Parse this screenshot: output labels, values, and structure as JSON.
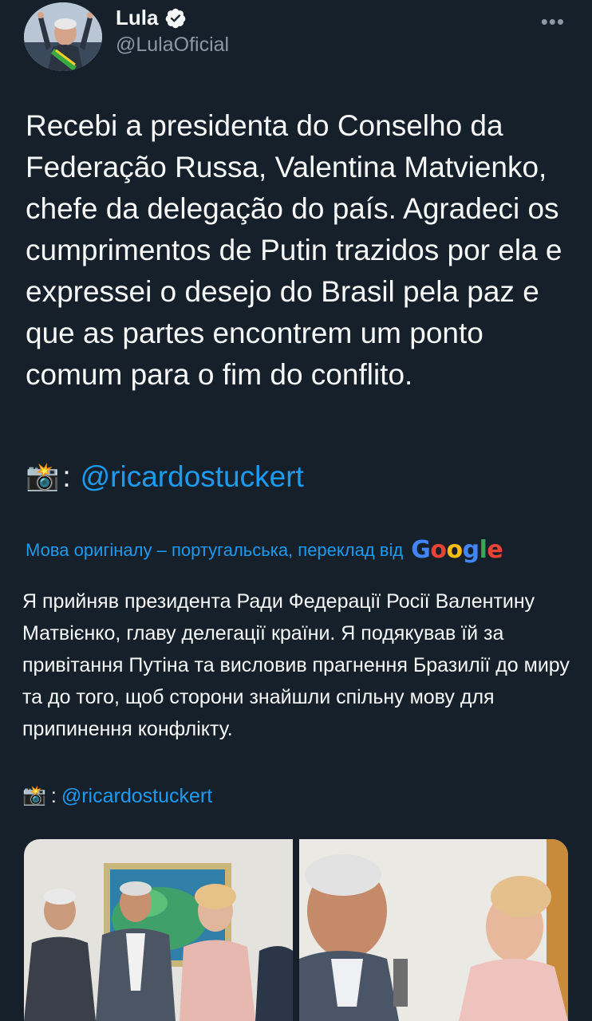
{
  "header": {
    "name": "Lula",
    "handle": "@LulaOficial",
    "verified_icon": "verified-badge-icon",
    "more_label": "•••"
  },
  "tweet": {
    "text": "Recebi a presidenta do Conselho da Federação Russa, Valentina Matvienko, chefe da delegação do país. Agradeci os cumprimentos de Putin trazidos por ela e expressei o desejo do Brasil pela paz e que as partes encontrem um ponto comum para o fim do conflito.",
    "credit_camera": "📸",
    "credit_separator": ":",
    "credit_link": "@ricardostuckert"
  },
  "translation": {
    "note": "Мова оригіналу – португальська, переклад від",
    "provider_parts": [
      "G",
      "o",
      "o",
      "g",
      "l",
      "e"
    ],
    "text": "Я прийняв президента Ради Федерації Росії Валентину Матвієнко, главу делегації країни. Я подякував їй за привітання Путіна та висловив прагнення Бразилії до миру та до того, щоб сторони знайшли спільну мову для припинення конфлікту.",
    "credit_camera": "📸",
    "credit_separator": ":",
    "credit_link": "@ricardostuckert"
  },
  "colors": {
    "background": "#15202b",
    "text": "#f7f9f9",
    "secondary": "#8b98a5",
    "link": "#1d9bf0"
  }
}
